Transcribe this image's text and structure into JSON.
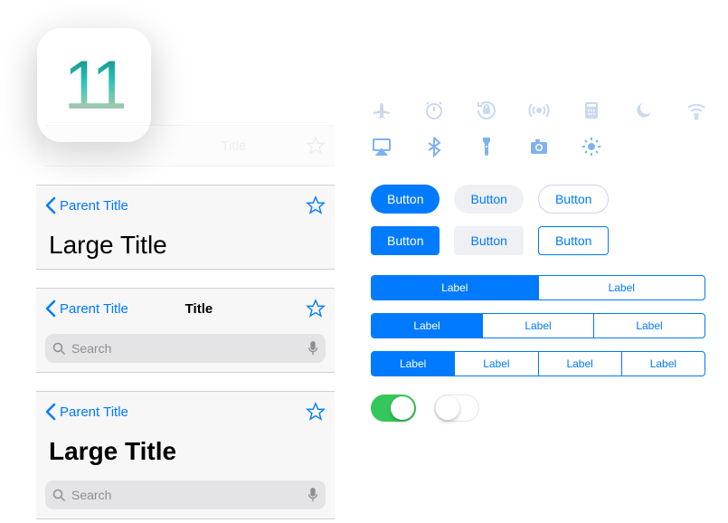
{
  "app_icon_label": "11",
  "navbars": {
    "faded": {
      "title": "Title"
    },
    "large1": {
      "back": "Parent Title",
      "large_title": "Large Title"
    },
    "small": {
      "back": "Parent Title",
      "title": "Title",
      "search_placeholder": "Search"
    },
    "large2": {
      "back": "Parent Title",
      "large_title": "Large Title",
      "search_placeholder": "Search"
    }
  },
  "buttons": {
    "pill_filled": "Button",
    "pill_gray": "Button",
    "pill_outline": "Button",
    "rect_filled": "Button",
    "rect_gray": "Button",
    "rect_outline": "Button"
  },
  "segments": {
    "s2": [
      "Label",
      "Label"
    ],
    "s3": [
      "Label",
      "Label",
      "Label"
    ],
    "s4": [
      "Label",
      "Label",
      "Label",
      "Label"
    ]
  },
  "switches": {
    "on": true,
    "off": false
  },
  "colors": {
    "tint": "#007aff",
    "switch_on": "#34c759"
  }
}
